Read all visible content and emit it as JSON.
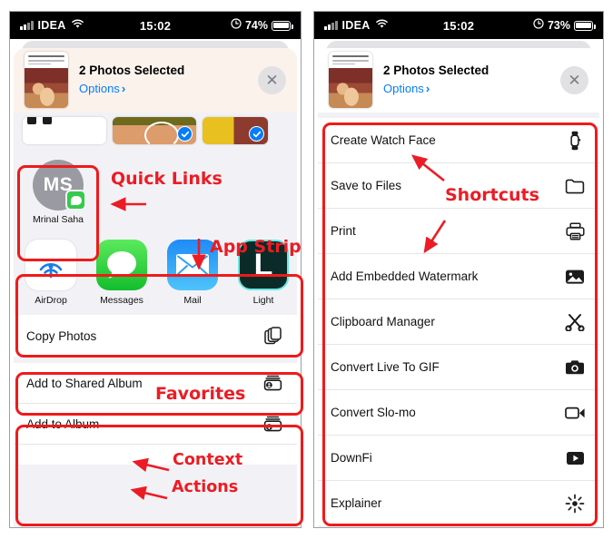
{
  "meta": {
    "accent_red": "#ec1c24",
    "link_blue": "#067dfa",
    "sheet_bg": "#f2f2f6"
  },
  "phones": [
    {
      "id": "left",
      "status_bar": {
        "carrier": "IDEA",
        "time": "15:02",
        "battery_percent": "74%",
        "signal_icon": "cellular-bars-icon",
        "wifi_icon": "wifi-icon",
        "alarm_icon": "alarm-icon",
        "battery_icon": "battery-icon"
      },
      "share_sheet": {
        "title": "2 Photos Selected",
        "options_label": "Options",
        "options_chevron": "chevron-right-icon",
        "close_icon": "close-icon",
        "thumbnail": "photo-thumbnail"
      },
      "photo_strip": [
        {
          "name": "photo-1",
          "selected": false
        },
        {
          "name": "photo-2",
          "selected": true
        },
        {
          "name": "photo-3",
          "selected": true
        }
      ],
      "quick_links": [
        {
          "name": "Mrinal Saha",
          "initials": "MS",
          "badge_app": "messages-badge-icon"
        }
      ],
      "app_strip": [
        {
          "label": "AirDrop",
          "icon": "airdrop-icon"
        },
        {
          "label": "Messages",
          "icon": "messages-icon"
        },
        {
          "label": "Mail",
          "icon": "mail-icon"
        },
        {
          "label": "Light",
          "icon": "lightroom-icon"
        }
      ],
      "favorites": [
        {
          "label": "Copy Photos",
          "icon": "copy-icon"
        }
      ],
      "context_actions": [
        {
          "label": "Add to Shared Album",
          "icon": "shared-album-icon"
        },
        {
          "label": "Add to Album",
          "icon": "add-album-icon"
        },
        {
          "label": "",
          "icon": "partial-row-icon"
        }
      ],
      "annotations": [
        {
          "text": "Quick Links"
        },
        {
          "text": "App Strip"
        },
        {
          "text": "Favorites"
        },
        {
          "text": "Context"
        },
        {
          "text": "Actions"
        }
      ]
    },
    {
      "id": "right",
      "status_bar": {
        "carrier": "IDEA",
        "time": "15:02",
        "battery_percent": "73%",
        "signal_icon": "cellular-bars-icon",
        "wifi_icon": "wifi-icon",
        "alarm_icon": "alarm-icon",
        "battery_icon": "battery-icon"
      },
      "share_sheet": {
        "title": "2 Photos Selected",
        "options_label": "Options",
        "options_chevron": "chevron-right-icon",
        "close_icon": "close-icon",
        "thumbnail": "photo-thumbnail"
      },
      "shortcuts": [
        {
          "label": "Create Watch Face",
          "icon": "apple-watch-icon"
        },
        {
          "label": "Save to Files",
          "icon": "folder-icon"
        },
        {
          "label": "Print",
          "icon": "printer-icon"
        },
        {
          "label": "Add Embedded Watermark",
          "icon": "photo-icon"
        },
        {
          "label": "Clipboard Manager",
          "icon": "scissors-icon"
        },
        {
          "label": "Convert Live To GIF",
          "icon": "camera-icon"
        },
        {
          "label": "Convert Slo-mo",
          "icon": "video-camera-icon"
        },
        {
          "label": "DownFi",
          "icon": "play-button-icon"
        },
        {
          "label": "Explainer",
          "icon": "sparkle-icon"
        }
      ],
      "annotations": [
        {
          "text": "Shortcuts"
        }
      ]
    }
  ]
}
